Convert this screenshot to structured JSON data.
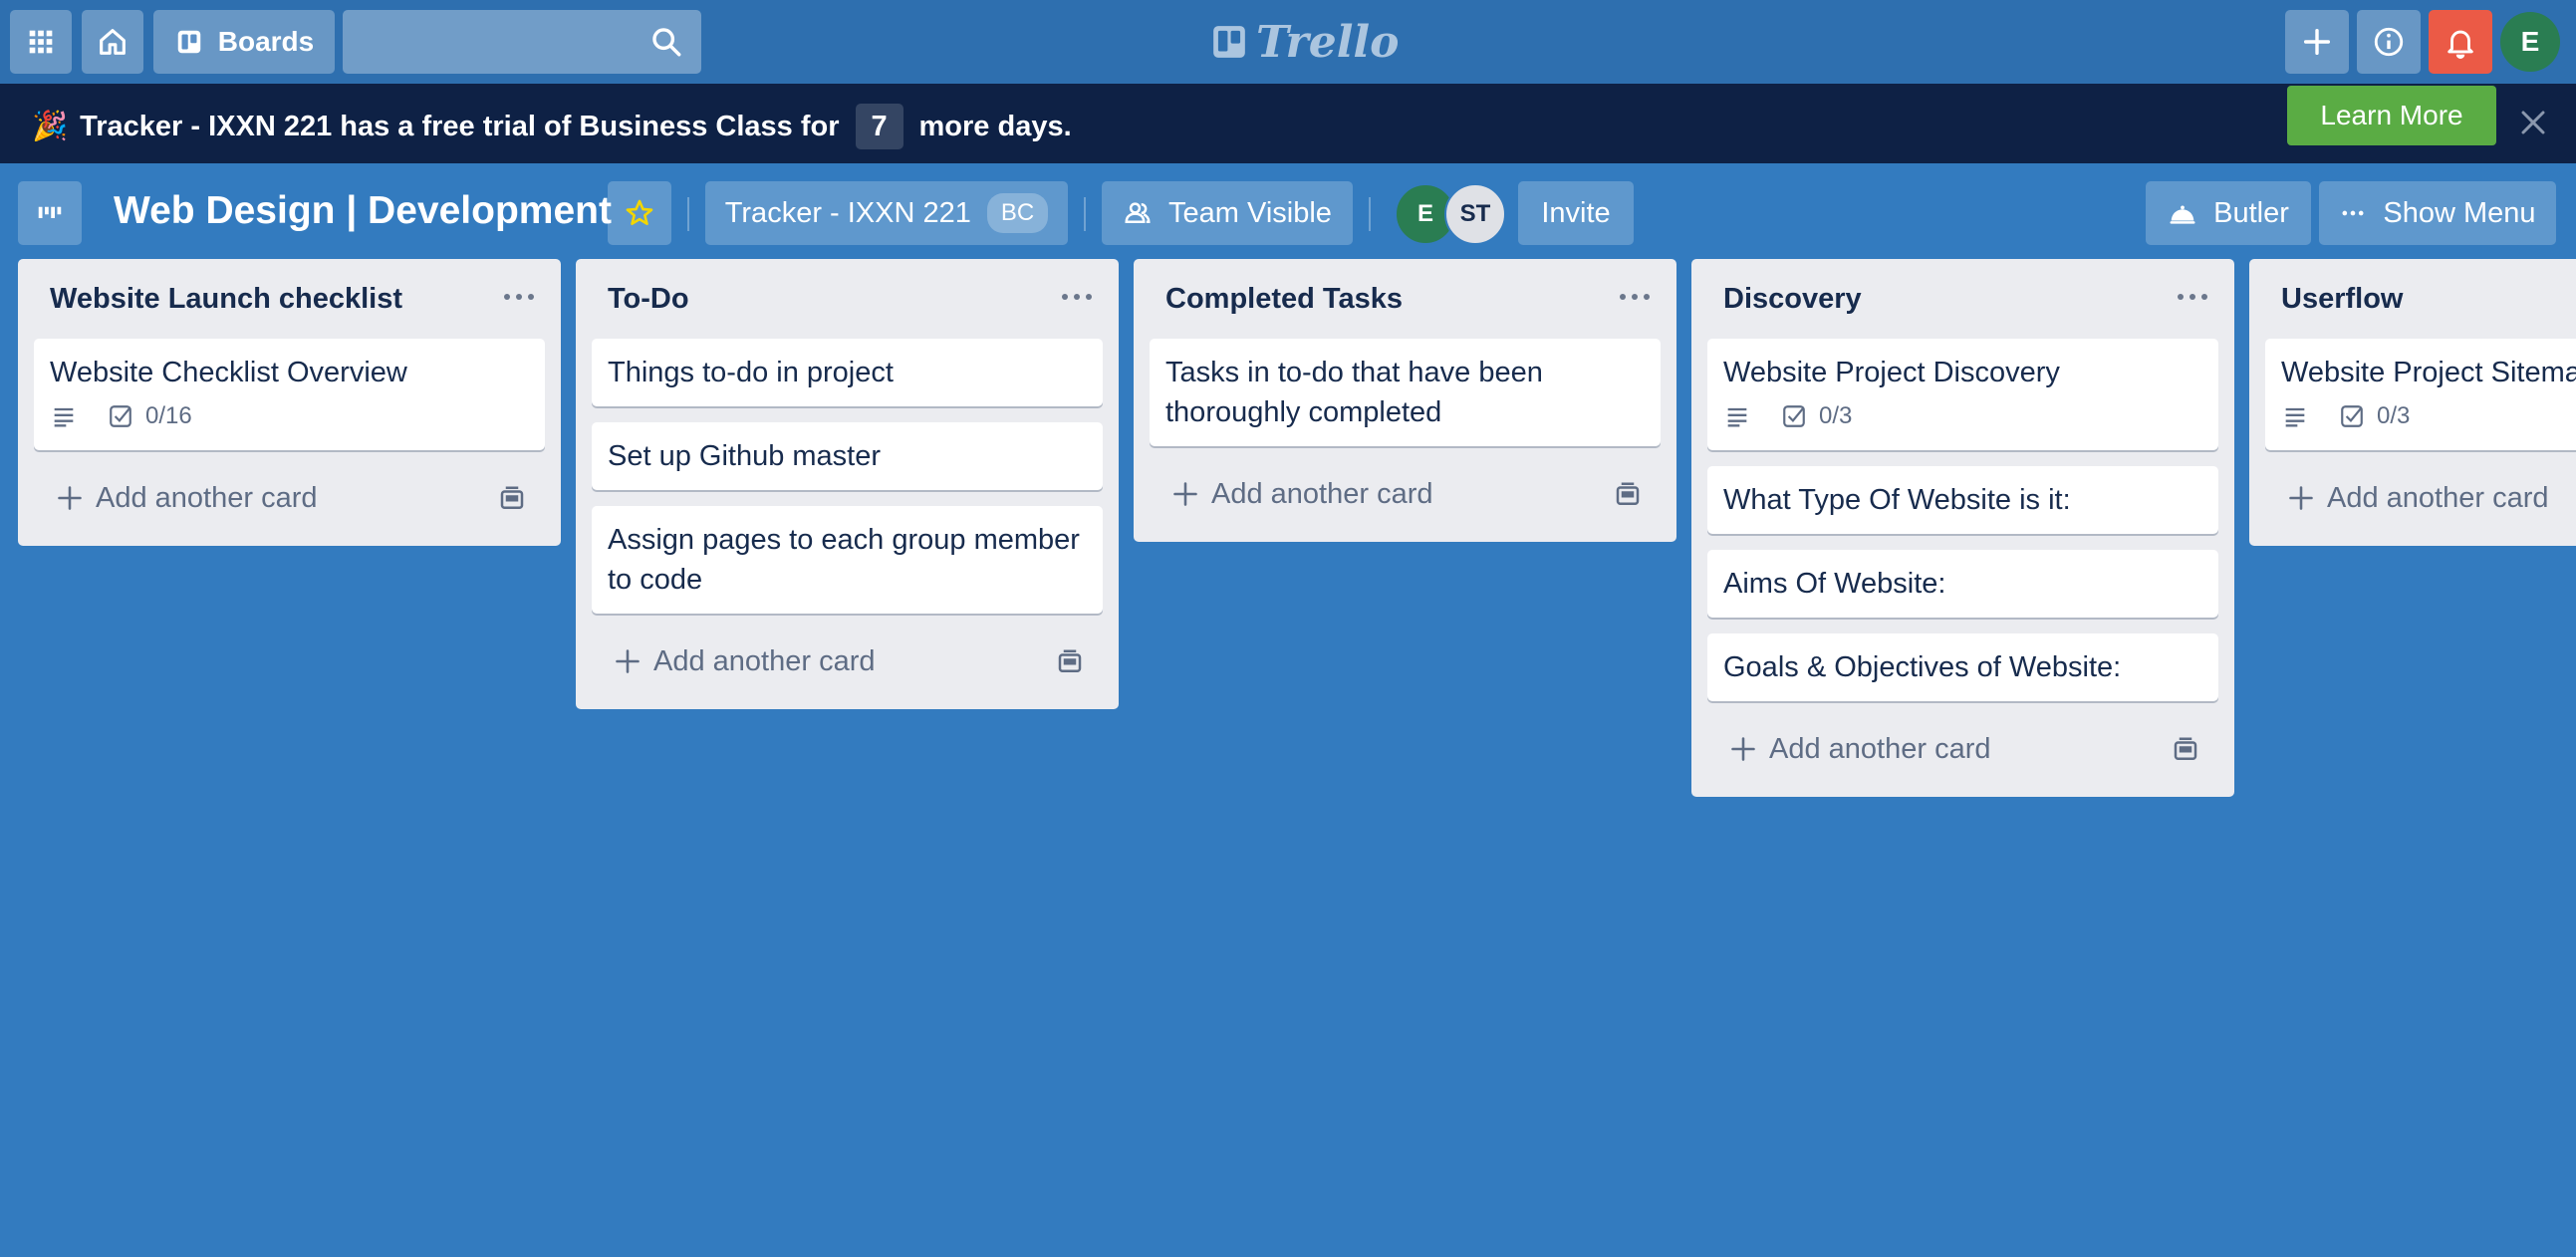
{
  "topbar": {
    "boards_label": "Boards",
    "logo_text": "Trello",
    "avatar_initial": "E"
  },
  "banner": {
    "emoji": "🎉",
    "text_before": "Tracker - IXXN 221 has a free trial of Business Class for",
    "days": "7",
    "text_after": "more days.",
    "learn_more": "Learn More"
  },
  "board": {
    "title": "Web Design | Development",
    "team_name": "Tracker - IXXN 221",
    "team_badge": "BC",
    "visibility": "Team Visible",
    "members": [
      "E",
      "ST"
    ],
    "invite": "Invite",
    "butler": "Butler",
    "show_menu": "Show Menu"
  },
  "lists": [
    {
      "title": "Website Launch checklist",
      "cards": [
        {
          "title": "Website Checklist Overview",
          "checklist": "0/16"
        }
      ],
      "add_label": "Add another card"
    },
    {
      "title": "To-Do",
      "cards": [
        {
          "title": "Things to-do in project"
        },
        {
          "title": "Set up Github master"
        },
        {
          "title": "Assign pages to each group member to code"
        }
      ],
      "add_label": "Add another card"
    },
    {
      "title": "Completed Tasks",
      "cards": [
        {
          "title": "Tasks in to-do that have been thoroughly completed"
        }
      ],
      "add_label": "Add another card"
    },
    {
      "title": "Discovery",
      "cards": [
        {
          "title": "Website Project Discovery",
          "checklist": "0/3"
        },
        {
          "title": "What Type Of Website is it:"
        },
        {
          "title": "Aims Of Website:"
        },
        {
          "title": "Goals & Objectives of Website:"
        }
      ],
      "add_label": "Add another card"
    },
    {
      "title": "Userflow",
      "cards": [
        {
          "title": "Website Project Sitemap",
          "checklist": "0/3"
        }
      ],
      "add_label": "Add another card"
    }
  ],
  "colors": {
    "board_bg": "#337bbf",
    "banner_bg": "#0e2145",
    "learn_more": "#5aac44",
    "notification": "#eb5a46",
    "avatar_green": "#2a7d52",
    "star": "#f2d600"
  }
}
